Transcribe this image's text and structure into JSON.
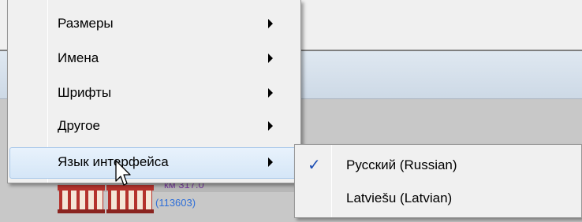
{
  "background": {
    "map_label": "км 317.0",
    "map_id": "(113603)"
  },
  "context_menu": {
    "items": [
      {
        "label": "Размеры",
        "has_submenu": true
      },
      {
        "label": "Имена",
        "has_submenu": true
      },
      {
        "label": "Шрифты",
        "has_submenu": true
      },
      {
        "label": "Другое",
        "has_submenu": true
      },
      {
        "label": "Язык интерфейса",
        "has_submenu": true,
        "highlighted": true
      }
    ]
  },
  "language_submenu": {
    "items": [
      {
        "label": "Русский (Russian)",
        "checked": true,
        "check_icon": "checkmark-icon"
      },
      {
        "label": "Latviešu (Latvian)",
        "checked": false
      }
    ]
  },
  "colors": {
    "highlight": "#d5e6f7",
    "check": "#1e4fb4",
    "station_icon": "#b4322d"
  }
}
